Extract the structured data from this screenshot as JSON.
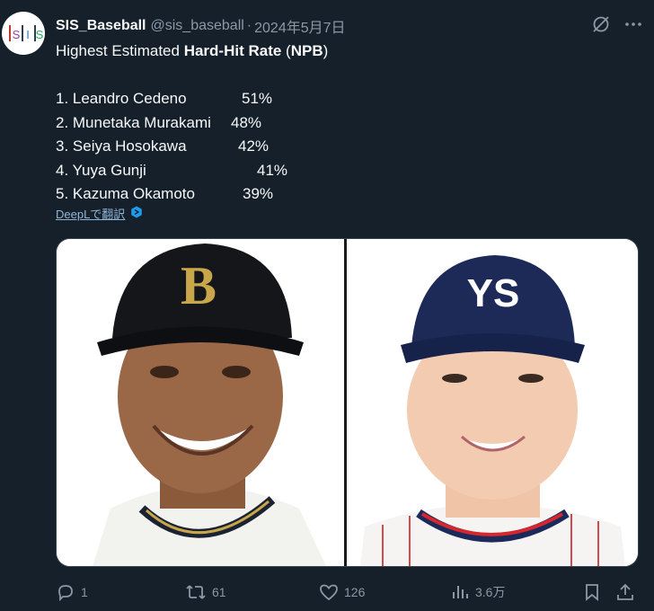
{
  "author": {
    "avatar_text": "SIS",
    "name": "SIS_Baseball",
    "handle": "@sis_baseball",
    "separator": "·",
    "timestamp": "2024年5月7日"
  },
  "tweet": {
    "title_prefix": "Highest Estimated ",
    "title_bold": "Hard-Hit Rate",
    "title_mid": " (",
    "title_bold2": "NPB",
    "title_suffix": ")",
    "rankings": [
      {
        "name": "1. Leandro Cedeno",
        "pct": "51%"
      },
      {
        "name": "2. Munetaka Murakami",
        "pct": "48%"
      },
      {
        "name": "3. Seiya Hosokawa",
        "pct": "42%"
      },
      {
        "name": "4. Yuya Gunji",
        "pct": "41%"
      },
      {
        "name": "5. Kazuma Okamoto",
        "pct": "39%"
      }
    ],
    "translate_label": "DeepLで翻訳"
  },
  "media": {
    "left_photo": "player-with-B-cap",
    "right_photo": "player-with-YS-cap"
  },
  "actions": {
    "replies": "1",
    "reposts": "61",
    "likes": "126",
    "views": "3.6万"
  },
  "colors": {
    "background": "#15202b",
    "text": "#f7f9f9",
    "muted": "#8b98a5",
    "link": "#1d9bf0"
  }
}
